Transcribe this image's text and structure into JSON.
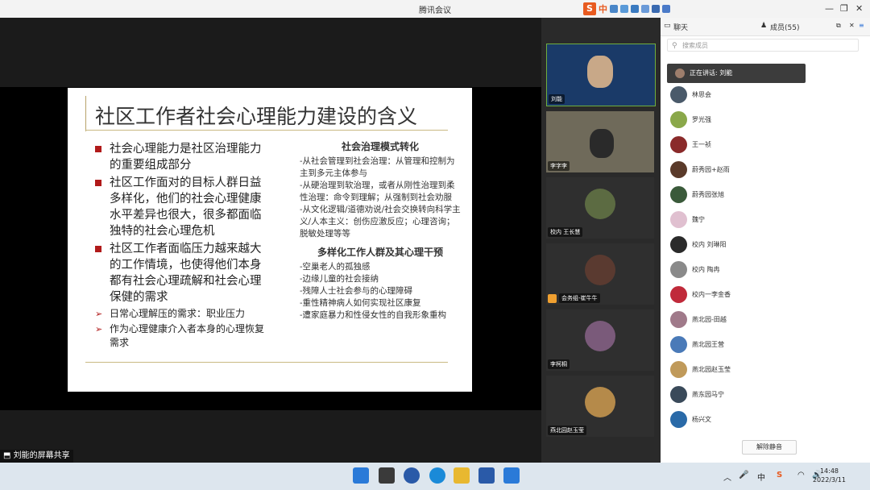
{
  "window": {
    "title": "腾讯会议",
    "ime_label": "中",
    "controls": [
      "—",
      "❐",
      "✕"
    ]
  },
  "slide": {
    "title": "社区工作者社会心理能力建设的含义",
    "bullets": [
      "社会心理能力是社区治理能力的重要组成部分",
      "社区工作面对的目标人群日益多样化，他们的社会心理健康水平差异也很大，很多都面临独特的社会心理危机",
      "社区工作者面临压力越来越大的工作情境，也使得他们本身都有社会心理疏解和社会心理保健的需求"
    ],
    "sub_bullets": [
      "日常心理解压的需求：职业压力",
      "作为心理健康介入者本身的心理恢复需求"
    ],
    "right_heading1": "社会治理模式转化",
    "right_items1": [
      "-从社会管理到社会治理：从管理和控制为主到多元主体参与",
      "-从硬治理到软治理，或者从刚性治理到柔性治理：命令到理解；从强制到社会劝服",
      "-从文化逻辑/道德劝说/社会交换转向科学主义/人本主义：创伤应激反应；心理咨询；脱敏处理等等"
    ],
    "right_heading2": "多样化工作人群及其心理干预",
    "right_items2": [
      "-空巢老人的孤独感",
      "-边缘儿童的社会接纳",
      "-残障人士社会参与的心理障碍",
      "-重性精神病人如何实现社区康复",
      "-遭家庭暴力和性侵女性的自我形象重构"
    ]
  },
  "share_label": "刘能的屏幕共享",
  "videos": [
    {
      "name": "刘能",
      "color": "#2a4a78"
    },
    {
      "name": "李字李",
      "color": "#6f6a5a"
    },
    {
      "name": "校内 王长慧",
      "color": "#5c6b42"
    },
    {
      "name": "会务组-崔牛牛",
      "color": "#5a3a30"
    },
    {
      "name": "李柯桐",
      "color": "#7a5a7a"
    },
    {
      "name": "燕北园赵玉莹",
      "color": "#b58a4a"
    }
  ],
  "panel": {
    "tab_chat": "聊天",
    "tab_members": "成员(55)",
    "search_placeholder": "搜索成员",
    "speaking": "正在讲话: 刘能",
    "members": [
      {
        "name": "林思会",
        "color": "#4a5a6a"
      },
      {
        "name": "罗光强",
        "color": "#8aa84a"
      },
      {
        "name": "王一祯",
        "color": "#8a2a2a"
      },
      {
        "name": "蔚秀园+赵雨",
        "color": "#5a3a2a"
      },
      {
        "name": "蔚秀园张旭",
        "color": "#3a5a3a"
      },
      {
        "name": "魏宁",
        "color": "#e0c0d0"
      },
      {
        "name": "校内 刘琳阳",
        "color": "#2a2a2a"
      },
      {
        "name": "校内 陶冉",
        "color": "#8a8a8a"
      },
      {
        "name": "校内一李金香",
        "color": "#c02a3a"
      },
      {
        "name": "燕北园-田越",
        "color": "#a07a8a"
      },
      {
        "name": "燕北园王营",
        "color": "#4a7ab8"
      },
      {
        "name": "燕北园赵玉莹",
        "color": "#c09a5a"
      },
      {
        "name": "燕东园马宁",
        "color": "#3a4a5a"
      },
      {
        "name": "杨兴文",
        "color": "#2a6aa8"
      }
    ],
    "unmute_button": "解除静音"
  },
  "taskbar": {
    "ime": "中",
    "time": "14:48",
    "date": "2022/3/11"
  }
}
